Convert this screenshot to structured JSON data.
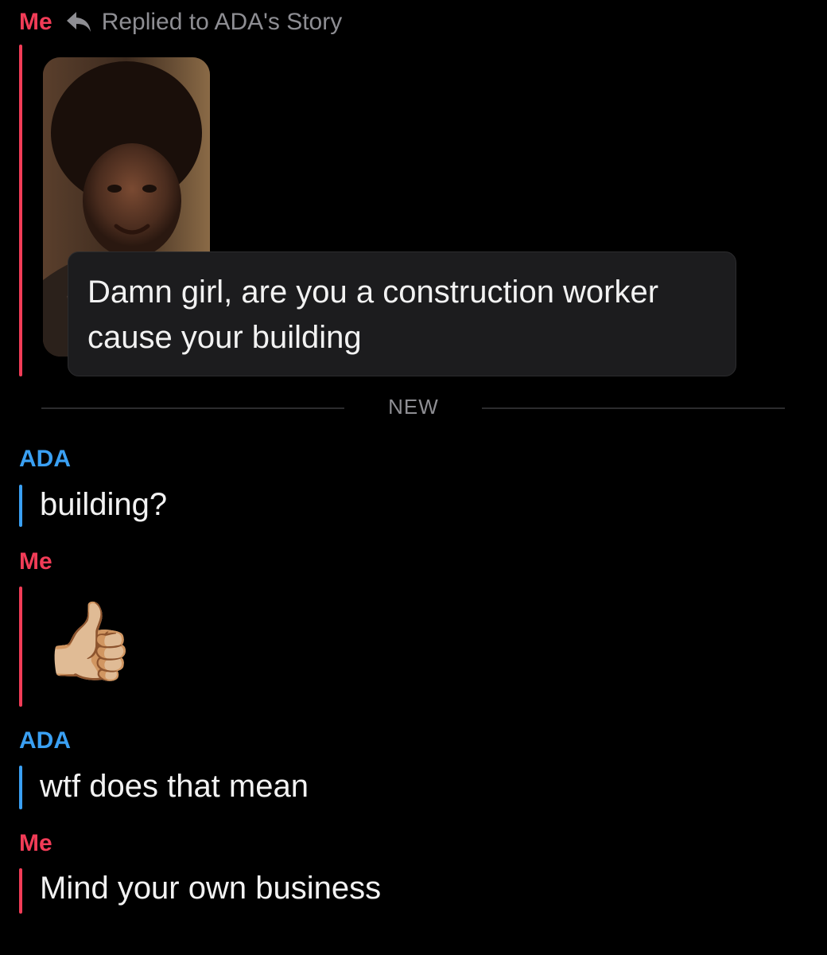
{
  "header": {
    "sender": "Me",
    "reply_label": "Replied to ADA's Story"
  },
  "story_reply": {
    "caption": "Damn girl, are you a construction worker cause your building"
  },
  "divider": {
    "label": "NEW"
  },
  "messages": [
    {
      "sender": "ADA",
      "text": "building?"
    },
    {
      "sender": "Me",
      "text": "👍🏼"
    },
    {
      "sender": "ADA",
      "text": "wtf does that mean"
    },
    {
      "sender": "Me",
      "text": "Mind your own business"
    }
  ],
  "colors": {
    "me": "#f23c57",
    "ada": "#3aa0f3",
    "background": "#000000",
    "bubble": "#1c1c1e",
    "muted": "#8e8e93"
  }
}
